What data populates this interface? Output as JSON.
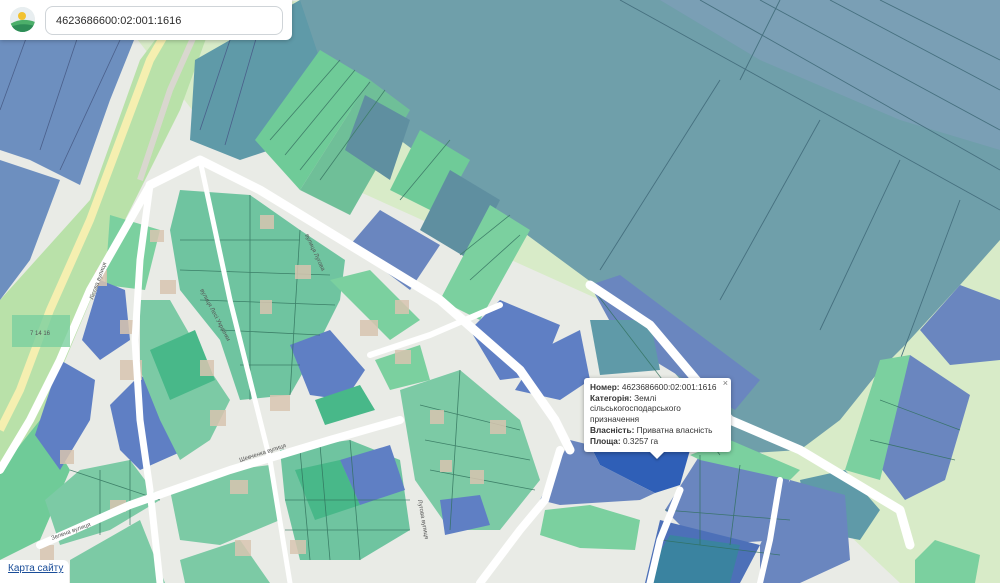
{
  "search": {
    "value": "4623686600:02:001:1616",
    "logo": "cadastre-logo-icon"
  },
  "popup": {
    "close_symbol": "×",
    "number_label": "Номер:",
    "number_value": "4623686600:02:001:1616",
    "category_label": "Категорія:",
    "category_value_1": "Землі",
    "category_value_2": "сільськогосподарського призначення",
    "ownership_label": "Власність:",
    "ownership_value": "Приватна власність",
    "area_label": "Площа:",
    "area_value": "0.3257 га"
  },
  "map": {
    "parcel_label": "7 14 16",
    "streets": [
      "вулиця Лугова",
      "вулиця Лесі Українки",
      "Шевченка вулиця",
      "Лісова вулиця",
      "Зелена вулиця",
      "Лугова вулиця"
    ]
  },
  "footer": {
    "site_map_link": "Карта сайту"
  },
  "colors": {
    "parcel_green": "#5fc69a",
    "parcel_blue": "#5f7fc4",
    "parcel_teal": "#5f9aa8",
    "highlight_blue": "#3a63ba",
    "road": "#ffffff",
    "background": "#e9ebe6"
  }
}
